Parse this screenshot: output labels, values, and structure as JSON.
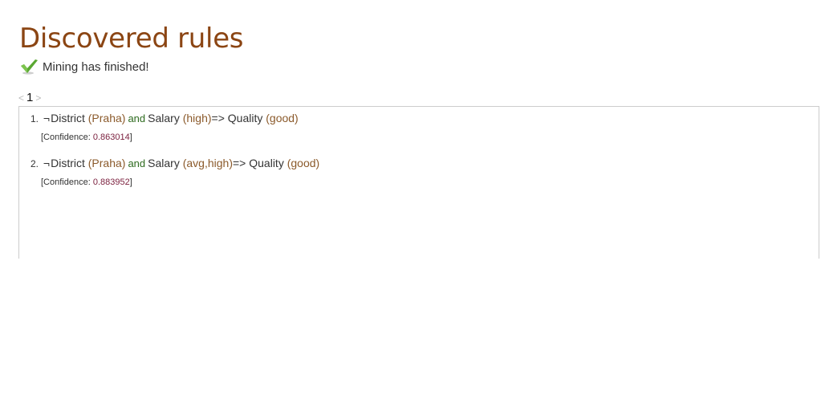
{
  "page": {
    "title": "Discovered rules",
    "status_text": "Mining has finished!"
  },
  "pager": {
    "prev": "<",
    "current": "1",
    "next": ">"
  },
  "rules": [
    {
      "number": "1.",
      "negation": "¬",
      "antecedent_attr": "District",
      "antecedent_val": "(Praha)",
      "connector": "and",
      "second_attr": "Salary",
      "second_val": "(high)",
      "arrow": "=>",
      "consequent_attr": "Quality",
      "consequent_val": "(good)",
      "confidence_label": "[Confidence: ",
      "confidence_value": "0.863014",
      "confidence_close": "]"
    },
    {
      "number": "2.",
      "negation": "¬",
      "antecedent_attr": "District",
      "antecedent_val": "(Praha)",
      "connector": "and",
      "second_attr": "Salary",
      "second_val": "(avg,high)",
      "arrow": "=>",
      "consequent_attr": "Quality",
      "consequent_val": "(good)",
      "confidence_label": "[Confidence: ",
      "confidence_value": "0.883952",
      "confidence_close": "]"
    }
  ],
  "colors": {
    "title": "#8b4513",
    "value": "#8b5a2b",
    "connector": "#2e6b1f",
    "confidence": "#7a1f3d",
    "check": "#5aa832"
  },
  "icons": {
    "status": "check-icon"
  }
}
